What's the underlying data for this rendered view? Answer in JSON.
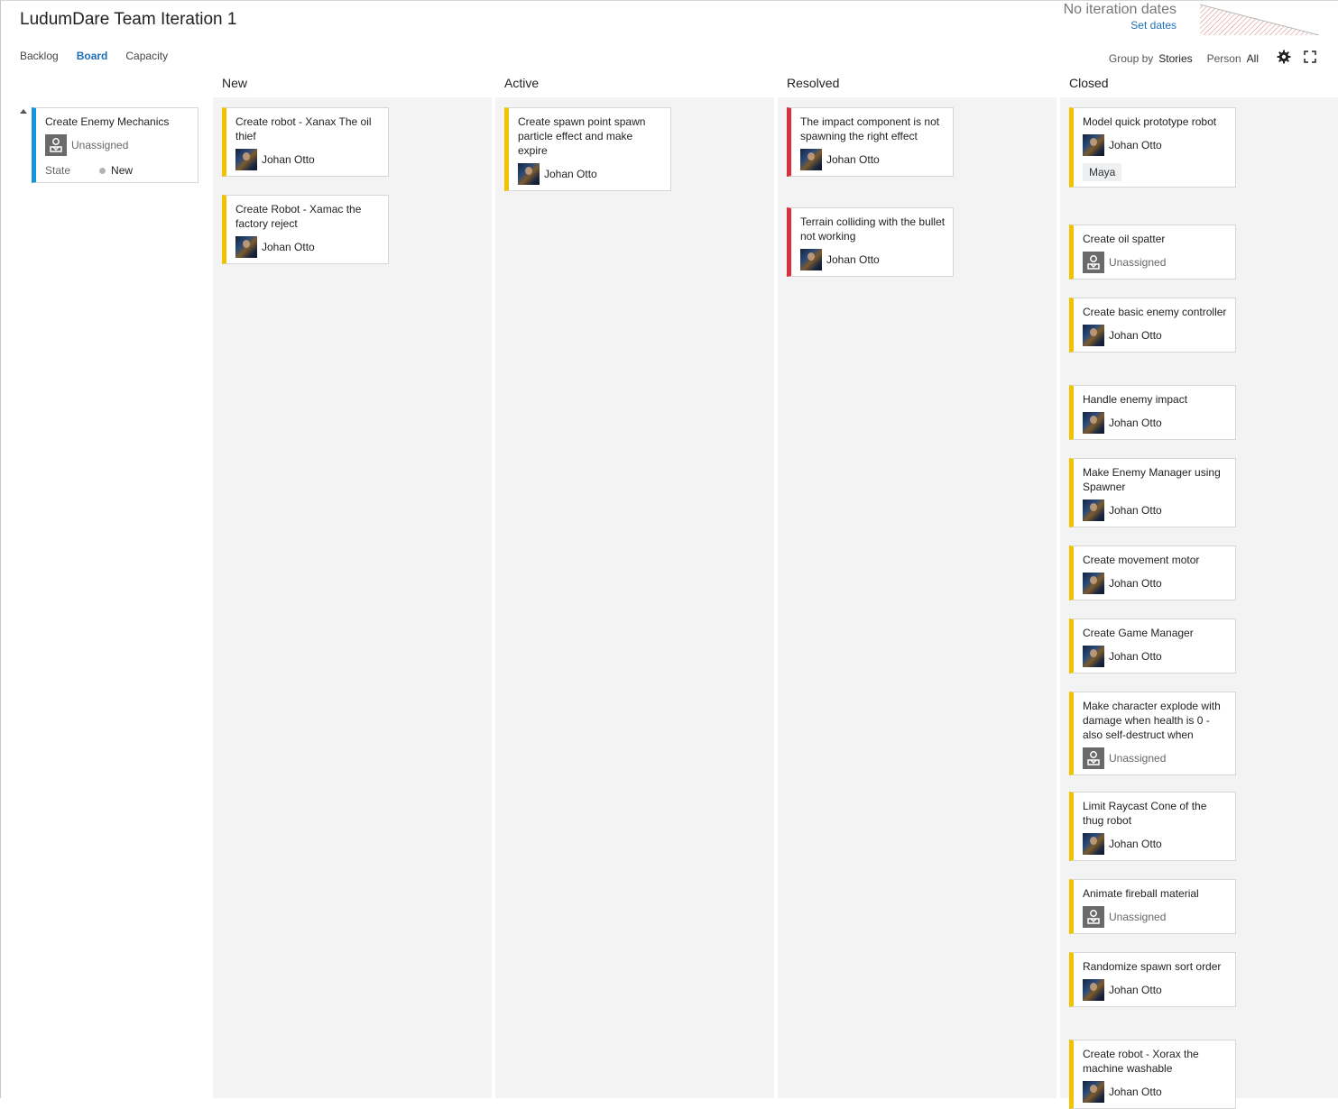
{
  "header": {
    "title": "LudumDare Team Iteration 1",
    "no_dates": "No iteration dates",
    "set_dates": "Set dates"
  },
  "tabs": [
    {
      "label": "Backlog",
      "active": false
    },
    {
      "label": "Board",
      "active": true
    },
    {
      "label": "Capacity",
      "active": false
    }
  ],
  "toolbar": {
    "group_by_label": "Group by",
    "group_by_value": "Stories",
    "person_label": "Person",
    "person_value": "All",
    "settings_icon": "gear-icon",
    "fullscreen_icon": "fullscreen-icon"
  },
  "colors": {
    "task": "#f2c200",
    "bug": "#d9303b",
    "story": "#1496d8",
    "link": "#1e6fb8"
  },
  "columns": [
    {
      "name": "New"
    },
    {
      "name": "Active"
    },
    {
      "name": "Resolved"
    },
    {
      "name": "Closed"
    }
  ],
  "story": {
    "title": "Create Enemy Mechanics",
    "assignee": "Unassigned",
    "state_label": "State",
    "state_value": "New"
  },
  "cards": {
    "new": [
      {
        "title": "Create robot - Xanax The oil thief",
        "assignee": "Johan Otto"
      },
      {
        "title": "Create Robot - Xamac the factory reject",
        "assignee": "Johan Otto"
      }
    ],
    "active": [
      {
        "title": "Create spawn point spawn particle effect and make expire",
        "assignee": "Johan Otto"
      }
    ],
    "resolved": [
      {
        "title": "The impact component is not spawning the right effect",
        "assignee": "Johan Otto"
      },
      {
        "title": "Terrain colliding with the bullet not working",
        "assignee": "Johan Otto"
      }
    ],
    "closed": [
      {
        "title": "Model quick prototype robot",
        "assignee": "Johan Otto",
        "tag": "Maya"
      },
      {
        "title": "Create oil spatter",
        "assignee": "Unassigned"
      },
      {
        "title": "Create basic enemy controller",
        "assignee": "Johan Otto"
      },
      {
        "title": "Handle enemy impact",
        "assignee": "Johan Otto"
      },
      {
        "title": "Make Enemy Manager using Spawner",
        "assignee": "Johan Otto"
      },
      {
        "title": "Create movement motor",
        "assignee": "Johan Otto"
      },
      {
        "title": "Create Game Manager",
        "assignee": "Johan Otto"
      },
      {
        "title": "Make character explode with damage when health is 0 - also self-destruct when",
        "assignee": "Unassigned"
      },
      {
        "title": "Limit Raycast Cone of the thug robot",
        "assignee": "Johan Otto"
      },
      {
        "title": "Animate fireball material",
        "assignee": "Unassigned"
      },
      {
        "title": "Randomize spawn sort order",
        "assignee": "Johan Otto"
      },
      {
        "title": "Create robot - Xorax the machine washable",
        "assignee": "Johan Otto"
      }
    ]
  }
}
